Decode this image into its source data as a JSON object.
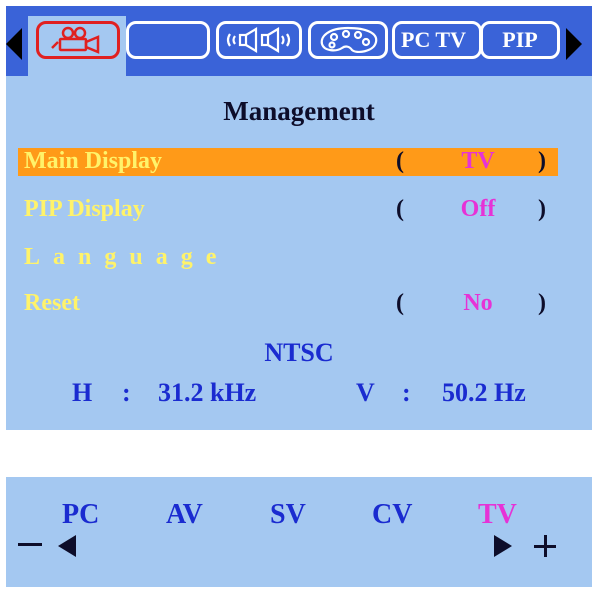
{
  "tabs": [
    {
      "name": "picture",
      "icon": "projector-icon",
      "active": true
    },
    {
      "name": "blank",
      "icon": "",
      "active": false
    },
    {
      "name": "audio",
      "icon": "speaker-icon",
      "active": false
    },
    {
      "name": "color",
      "icon": "palette-icon",
      "active": false
    },
    {
      "name": "pc_tv",
      "label": "PC TV",
      "active": false
    },
    {
      "name": "pip",
      "label": "PIP",
      "active": false
    }
  ],
  "menu": {
    "title": "Management",
    "items": [
      {
        "label": "Main Display",
        "value": "TV",
        "selected": true
      },
      {
        "label": "PIP Display",
        "value": "Off",
        "selected": false
      },
      {
        "label": "Language",
        "value": "",
        "selected": false
      },
      {
        "label": "Reset",
        "value": "No",
        "selected": false
      }
    ],
    "paren_open": "(",
    "paren_close": ")"
  },
  "signal": {
    "standard": "NTSC",
    "h_label": "H",
    "h_value": "31.2 kHz",
    "v_label": "V",
    "v_value": "50.2 Hz",
    "separator": ":"
  },
  "source_bar": {
    "sources": [
      "PC",
      "AV",
      "SV",
      "CV",
      "TV"
    ],
    "active": "TV",
    "minus": "−",
    "plus": "+"
  },
  "colors": {
    "panel_bg": "#a4c8f1",
    "tabbar_bg": "#3a63d8",
    "highlight": "#ff9a18",
    "label_yellow": "#fff36a",
    "value_magenta": "#e632d6",
    "info_blue": "#1a2bd0"
  }
}
